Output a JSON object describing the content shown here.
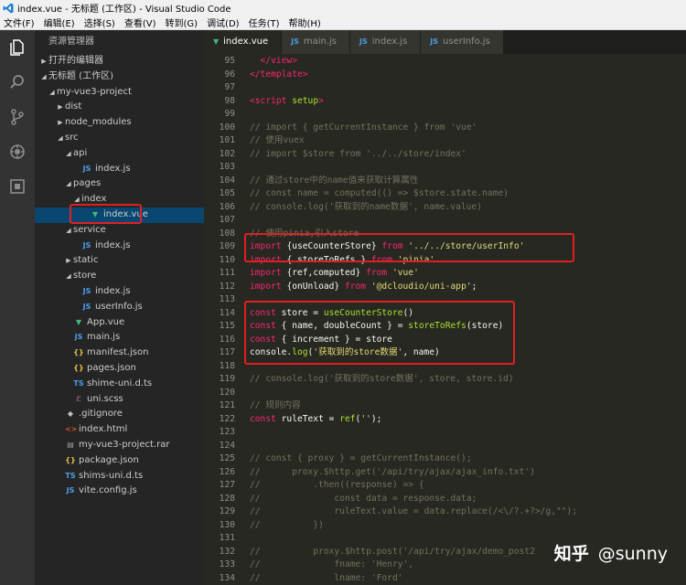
{
  "window": {
    "title": "index.vue - 无标题 (工作区) - Visual Studio Code"
  },
  "menu": [
    "文件(F)",
    "编辑(E)",
    "选择(S)",
    "查看(V)",
    "转到(G)",
    "调试(D)",
    "任务(T)",
    "帮助(H)"
  ],
  "sidebar": {
    "header": "资源管理器",
    "tree": [
      {
        "label": "打开的编辑器",
        "depth": 0,
        "arrow": "▶",
        "icon": ""
      },
      {
        "label": "无标题 (工作区)",
        "depth": 0,
        "arrow": "◢",
        "icon": ""
      },
      {
        "label": "my-vue3-project",
        "depth": 1,
        "arrow": "◢",
        "icon": ""
      },
      {
        "label": "dist",
        "depth": 2,
        "arrow": "▶",
        "icon": ""
      },
      {
        "label": "node_modules",
        "depth": 2,
        "arrow": "▶",
        "icon": ""
      },
      {
        "label": "src",
        "depth": 2,
        "arrow": "◢",
        "icon": ""
      },
      {
        "label": "api",
        "depth": 3,
        "arrow": "◢",
        "icon": ""
      },
      {
        "label": "index.js",
        "depth": 4,
        "arrow": "",
        "icon": "js"
      },
      {
        "label": "pages",
        "depth": 3,
        "arrow": "◢",
        "icon": ""
      },
      {
        "label": "index",
        "depth": 4,
        "arrow": "◢",
        "icon": ""
      },
      {
        "label": "index.vue",
        "depth": 5,
        "arrow": "",
        "icon": "vue",
        "selected": true
      },
      {
        "label": "service",
        "depth": 3,
        "arrow": "◢",
        "icon": ""
      },
      {
        "label": "index.js",
        "depth": 4,
        "arrow": "",
        "icon": "js"
      },
      {
        "label": "static",
        "depth": 3,
        "arrow": "▶",
        "icon": ""
      },
      {
        "label": "store",
        "depth": 3,
        "arrow": "◢",
        "icon": ""
      },
      {
        "label": "index.js",
        "depth": 4,
        "arrow": "",
        "icon": "js"
      },
      {
        "label": "userInfo.js",
        "depth": 4,
        "arrow": "",
        "icon": "js"
      },
      {
        "label": "App.vue",
        "depth": 3,
        "arrow": "",
        "icon": "vue"
      },
      {
        "label": "main.js",
        "depth": 3,
        "arrow": "",
        "icon": "js"
      },
      {
        "label": "manifest.json",
        "depth": 3,
        "arrow": "",
        "icon": "json"
      },
      {
        "label": "pages.json",
        "depth": 3,
        "arrow": "",
        "icon": "json"
      },
      {
        "label": "shime-uni.d.ts",
        "depth": 3,
        "arrow": "",
        "icon": "ts"
      },
      {
        "label": "uni.scss",
        "depth": 3,
        "arrow": "",
        "icon": "scss"
      },
      {
        "label": ".gitignore",
        "depth": 2,
        "arrow": "",
        "icon": "git"
      },
      {
        "label": "index.html",
        "depth": 2,
        "arrow": "",
        "icon": "html"
      },
      {
        "label": "my-vue3-project.rar",
        "depth": 2,
        "arrow": "",
        "icon": "rar"
      },
      {
        "label": "package.json",
        "depth": 2,
        "arrow": "",
        "icon": "json"
      },
      {
        "label": "shims-uni.d.ts",
        "depth": 2,
        "arrow": "",
        "icon": "ts"
      },
      {
        "label": "vite.config.js",
        "depth": 2,
        "arrow": "",
        "icon": "js"
      }
    ]
  },
  "icons": {
    "js": "JS",
    "json": "{}",
    "ts": "TS",
    "vue": "▼",
    "scss": "ℰ",
    "git": "◆",
    "html": "<>",
    "rar": "▤"
  },
  "tabs": [
    {
      "label": "index.vue",
      "icon": "vue",
      "active": true
    },
    {
      "label": "main.js",
      "icon": "js",
      "active": false
    },
    {
      "label": "index.js",
      "icon": "js",
      "active": false
    },
    {
      "label": "userInfo.js",
      "icon": "js",
      "active": false
    }
  ],
  "code": [
    {
      "n": "95",
      "t": [
        [
          "c-tag",
          "  </view>"
        ]
      ]
    },
    {
      "n": "96",
      "t": [
        [
          "c-tag",
          "</template>"
        ]
      ]
    },
    {
      "n": "97",
      "t": []
    },
    {
      "n": "98",
      "t": [
        [
          "c-tag",
          "<script "
        ],
        [
          "c-attr",
          "setup"
        ],
        [
          "c-tag",
          ">"
        ]
      ]
    },
    {
      "n": "99",
      "t": []
    },
    {
      "n": "100",
      "t": [
        [
          "c-com",
          "// import { getCurrentInstance } from 'vue'"
        ]
      ]
    },
    {
      "n": "101",
      "t": [
        [
          "c-com",
          "// 使用vuex"
        ]
      ]
    },
    {
      "n": "102",
      "t": [
        [
          "c-com",
          "// import $store from '../../store/index'"
        ]
      ]
    },
    {
      "n": "103",
      "t": []
    },
    {
      "n": "104",
      "t": [
        [
          "c-com",
          "// 通过store中的name值来获取计算属性"
        ]
      ]
    },
    {
      "n": "105",
      "t": [
        [
          "c-com",
          "// const name = computed(() => $store.state.name)"
        ]
      ]
    },
    {
      "n": "106",
      "t": [
        [
          "c-com",
          "// console.log('获取到的name数据', name.value)"
        ]
      ]
    },
    {
      "n": "107",
      "t": []
    },
    {
      "n": "108",
      "t": [
        [
          "c-com",
          "// 使用pinia,引入store"
        ]
      ]
    },
    {
      "n": "109",
      "t": [
        [
          "c-kw",
          "import "
        ],
        [
          "c-var",
          "{useCounterStore} "
        ],
        [
          "c-kw",
          "from "
        ],
        [
          "c-str",
          "'../../store/userInfo'"
        ]
      ]
    },
    {
      "n": "110",
      "t": [
        [
          "c-kw",
          "import "
        ],
        [
          "c-var",
          "{ storeToRefs } "
        ],
        [
          "c-kw",
          "from "
        ],
        [
          "c-str",
          "'pinia'"
        ]
      ]
    },
    {
      "n": "111",
      "t": [
        [
          "c-kw",
          "import "
        ],
        [
          "c-var",
          "{ref,computed} "
        ],
        [
          "c-kw",
          "from "
        ],
        [
          "c-str",
          "'vue'"
        ]
      ]
    },
    {
      "n": "112",
      "t": [
        [
          "c-kw",
          "import "
        ],
        [
          "c-var",
          "{onUnload} "
        ],
        [
          "c-kw",
          "from "
        ],
        [
          "c-str",
          "'@dcloudio/uni-app'"
        ],
        [
          "c-var",
          ";"
        ]
      ]
    },
    {
      "n": "113",
      "t": []
    },
    {
      "n": "114",
      "t": [
        [
          "c-kw",
          "const "
        ],
        [
          "c-var",
          "store = "
        ],
        [
          "c-fn",
          "useCounterStore"
        ],
        [
          "c-var",
          "()"
        ]
      ]
    },
    {
      "n": "115",
      "t": [
        [
          "c-kw",
          "const "
        ],
        [
          "c-var",
          "{ name, doubleCount } = "
        ],
        [
          "c-fn",
          "storeToRefs"
        ],
        [
          "c-var",
          "(store)"
        ]
      ]
    },
    {
      "n": "116",
      "t": [
        [
          "c-kw",
          "const "
        ],
        [
          "c-var",
          "{ increment } = store"
        ]
      ]
    },
    {
      "n": "117",
      "t": [
        [
          "c-var",
          "console."
        ],
        [
          "c-fn",
          "log"
        ],
        [
          "c-var",
          "("
        ],
        [
          "c-str",
          "'获取到的store数据'"
        ],
        [
          "c-var",
          ", name)"
        ]
      ]
    },
    {
      "n": "118",
      "t": []
    },
    {
      "n": "119",
      "t": [
        [
          "c-com",
          "// console.log('获取到的store数据', store, store.id)"
        ]
      ]
    },
    {
      "n": "120",
      "t": []
    },
    {
      "n": "121",
      "t": [
        [
          "c-com",
          "// 规则内容"
        ]
      ]
    },
    {
      "n": "122",
      "t": [
        [
          "c-kw",
          "const "
        ],
        [
          "c-var",
          "ruleText = "
        ],
        [
          "c-fn",
          "ref"
        ],
        [
          "c-var",
          "("
        ],
        [
          "c-str",
          "''"
        ],
        [
          "c-var",
          ");"
        ]
      ]
    },
    {
      "n": "123",
      "t": []
    },
    {
      "n": "124",
      "t": []
    },
    {
      "n": "125",
      "t": [
        [
          "c-com",
          "// const { proxy } = getCurrentInstance();"
        ]
      ]
    },
    {
      "n": "126",
      "t": [
        [
          "c-com",
          "//      proxy.$http.get('/api/try/ajax/ajax_info.txt')"
        ]
      ]
    },
    {
      "n": "127",
      "t": [
        [
          "c-com",
          "//          .then((response) => {"
        ]
      ]
    },
    {
      "n": "128",
      "t": [
        [
          "c-com",
          "//              const data = response.data;"
        ]
      ]
    },
    {
      "n": "129",
      "t": [
        [
          "c-com",
          "//              ruleText.value = data.replace(/<\\/?.+?>/g,\"\");"
        ]
      ]
    },
    {
      "n": "130",
      "t": [
        [
          "c-com",
          "//          })"
        ]
      ]
    },
    {
      "n": "131",
      "t": []
    },
    {
      "n": "132",
      "t": [
        [
          "c-com",
          "//          proxy.$http.post('/api/try/ajax/demo_post2"
        ]
      ]
    },
    {
      "n": "133",
      "t": [
        [
          "c-com",
          "//              fname: 'Henry',"
        ]
      ]
    },
    {
      "n": "134",
      "t": [
        [
          "c-com",
          "//              lname: 'Ford'"
        ]
      ]
    }
  ],
  "watermark": {
    "site": "知乎",
    "user": "@sunny"
  }
}
